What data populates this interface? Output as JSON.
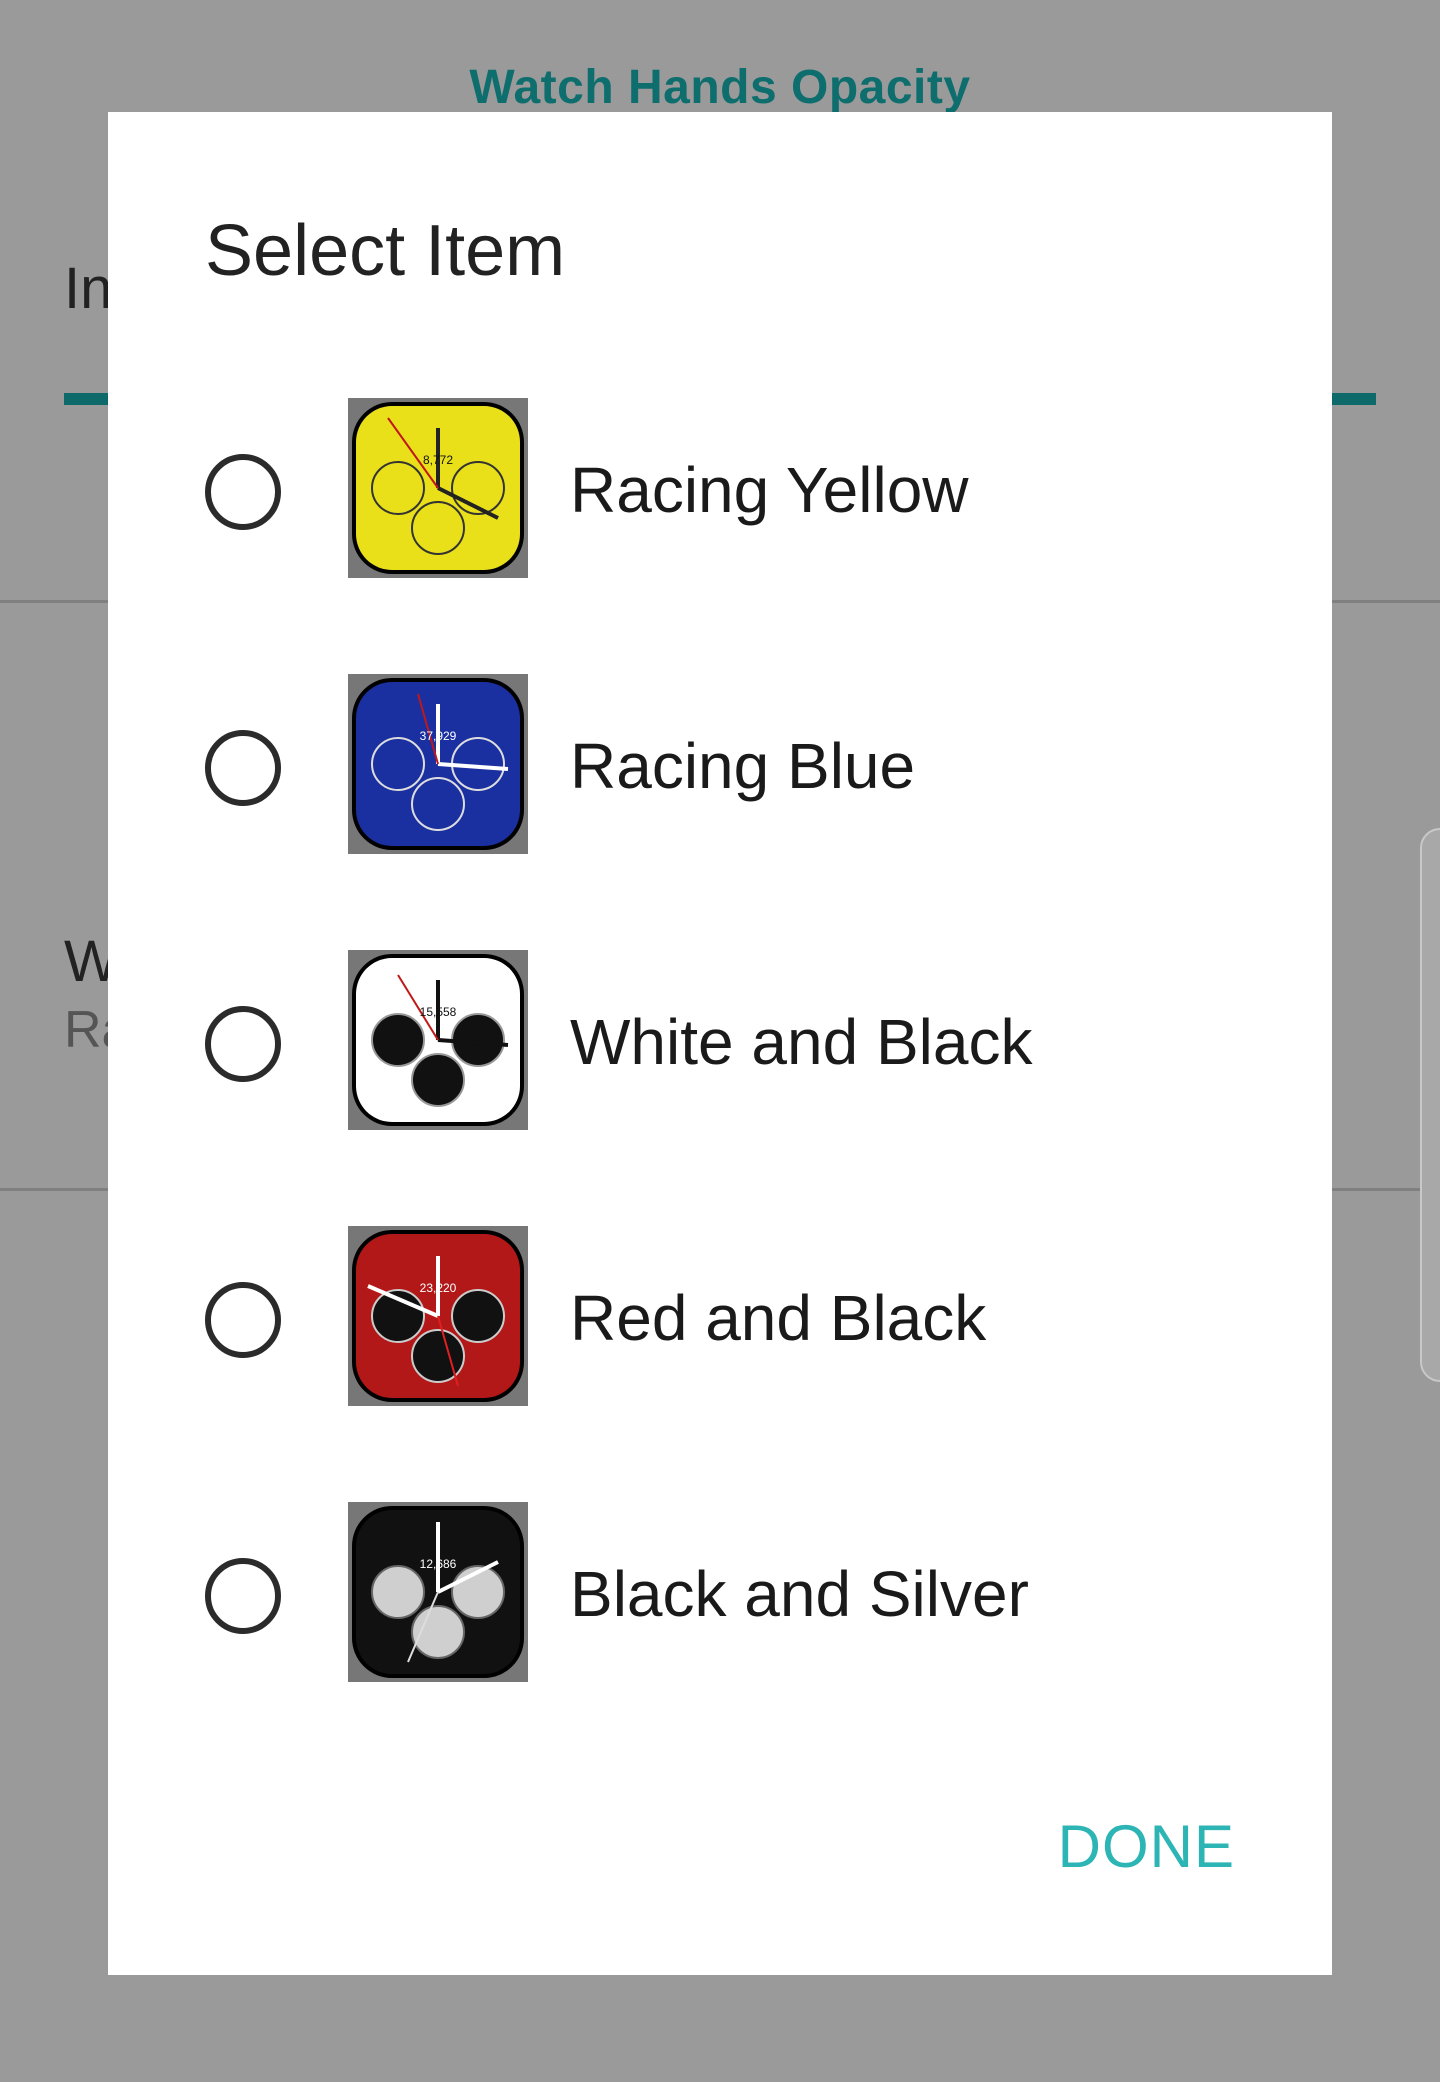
{
  "background": {
    "title": "Watch Hands Opacity",
    "tab_label": "In",
    "setting_title": "W",
    "setting_value": "Ra",
    "colors": {
      "accent": "#0e6e6e",
      "scrim": "#9a9a9a"
    }
  },
  "dialog": {
    "title": "Select Item",
    "options": [
      {
        "label": "Racing Yellow",
        "face_color": "#e9e01a",
        "subdial_color": "#e9e01a",
        "steps": "8,772",
        "selected": false
      },
      {
        "label": "Racing Blue",
        "face_color": "#1a2fa0",
        "subdial_color": "#1a2fa0",
        "steps": "37,929",
        "selected": false
      },
      {
        "label": "White and Black",
        "face_color": "#ffffff",
        "subdial_color": "#111111",
        "steps": "15,558",
        "selected": false
      },
      {
        "label": "Red and Black",
        "face_color": "#b31818",
        "subdial_color": "#111111",
        "steps": "23,220",
        "selected": false
      },
      {
        "label": "Black and Silver",
        "face_color": "#111111",
        "subdial_color": "#cfcfcf",
        "steps": "12,686",
        "selected": false
      }
    ],
    "done_label": "DONE",
    "colors": {
      "done": "#2db5b5",
      "radio": "#2b2b2b"
    }
  }
}
